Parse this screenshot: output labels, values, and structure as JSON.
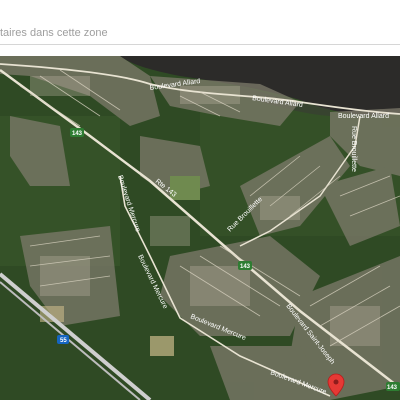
{
  "search": {
    "text": "taires dans cette zone"
  },
  "map": {
    "roads": {
      "allard_1": "Boulevard Allard",
      "allard_2": "Boulevard Allard",
      "allard_3": "Boulevard Allard",
      "brouillette_1": "Rue Brouillette",
      "brouillette_2": "Rue Brouillette",
      "mercure_1": "Boulevard Mercure",
      "mercure_2": "Boulevard Mercure",
      "mercure_3": "Boulevard Mercure",
      "mercure_4": "Boulevard Mercure",
      "st_joseph": "Boulevard Saint-Joseph",
      "rte143": "Rte 143"
    },
    "shields": {
      "a": "143",
      "b": "143",
      "c": "55",
      "d": "143"
    },
    "colors": {
      "water": "#2c2b29",
      "forest": "#2f4a24",
      "pin": "#e53935"
    }
  }
}
